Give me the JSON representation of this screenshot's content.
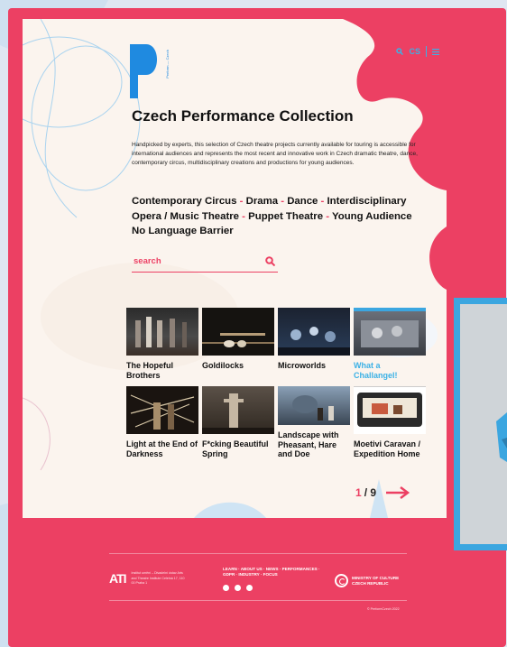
{
  "colors": {
    "accent": "#ec4063",
    "link": "#3bb1e6",
    "text": "#111111"
  },
  "brand": {
    "logo_letter": "P",
    "logo_side_text": "Perform — Czech"
  },
  "nav": {
    "search_icon": "search-icon",
    "lang": "CS",
    "menu_icon": "menu-icon"
  },
  "hero": {
    "title": "Czech Performance Collection",
    "intro": "Handpicked by experts, this selection of Czech theatre projects currently available for touring is accessible for international audiences and represents the most recent and innovative work in Czech dramatic theatre, dance, contemporary circus, multidisciplinary creations and productions for young audiences."
  },
  "categories": [
    "Contemporary Circus",
    "Drama",
    "Dance",
    "Interdisciplinary",
    "Opera / Music Theatre",
    "Puppet Theatre",
    "Young Audience",
    "No Language Barrier"
  ],
  "search": {
    "placeholder": "search"
  },
  "productions": [
    {
      "title": "The Hopeful Brothers"
    },
    {
      "title": "Goldilocks"
    },
    {
      "title": "Microworlds"
    },
    {
      "title": "What a Challangel!",
      "highlight": true
    },
    {
      "title": "Light at the End of Darkness"
    },
    {
      "title": "F*cking Beautiful Spring"
    },
    {
      "title": "Landscape with Pheasant, Hare and Doe"
    },
    {
      "title": "Moetivi Caravan / Expedition Home"
    }
  ],
  "pager": {
    "current": "1",
    "total": "/ 9"
  },
  "footer": {
    "ati_logo": "ATI",
    "ati_text": "Institut umění – Divadelní ústav Arts and Theatre Institute Celetná 17, 110 00 Praha 1",
    "links": "LEARN · ABOUT US · NEWS · PERFORMANCES · GDPR · INDUSTRY · FOCUS",
    "social": [
      "instagram-icon",
      "facebook-icon",
      "youtube-icon"
    ],
    "ministry": "MINISTRY OF CULTURE CZECH REPUBLIC",
    "copyright": "© PerformCzech 2022"
  }
}
